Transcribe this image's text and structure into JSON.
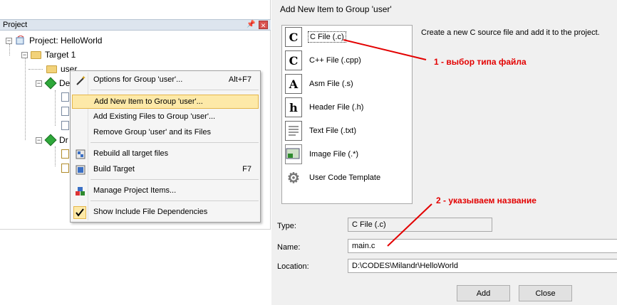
{
  "project_panel": {
    "title": "Project",
    "tree": {
      "project": "Project: HelloWorld",
      "target": "Target 1",
      "group_user": "user",
      "group_device": "De",
      "group_drivers": "Dr"
    }
  },
  "context_menu": {
    "items": [
      {
        "label": "Options for Group 'user'...",
        "shortcut": "Alt+F7",
        "icon": "magic-wand-icon"
      },
      {
        "label": "Add New  Item to Group 'user'...",
        "shortcut": "",
        "icon": ""
      },
      {
        "label": "Add Existing Files to Group 'user'...",
        "shortcut": "",
        "icon": ""
      },
      {
        "label": "Remove Group 'user' and its Files",
        "shortcut": "",
        "icon": ""
      },
      {
        "label": "Rebuild all target files",
        "shortcut": "",
        "icon": "rebuild-icon"
      },
      {
        "label": "Build Target",
        "shortcut": "F7",
        "icon": "build-icon"
      },
      {
        "label": "Manage Project Items...",
        "shortcut": "",
        "icon": "manage-items-icon"
      },
      {
        "label": "Show Include File Dependencies",
        "shortcut": "",
        "icon": "checkmark-icon"
      }
    ]
  },
  "dialog": {
    "title": "Add New Item to Group 'user'",
    "description": "Create a new C source file and add it to the project.",
    "file_types": [
      {
        "label": "C File (.c)",
        "glyph": "C"
      },
      {
        "label": "C++ File (.cpp)",
        "glyph": "C"
      },
      {
        "label": "Asm File (.s)",
        "glyph": "A"
      },
      {
        "label": "Header File (.h)",
        "glyph": "h"
      },
      {
        "label": "Text File (.txt)",
        "glyph": ""
      },
      {
        "label": "Image File (.*)",
        "glyph": ""
      },
      {
        "label": "User Code Template",
        "glyph": ""
      }
    ],
    "type_label": "Type:",
    "type_value": "C File (.c)",
    "name_label": "Name:",
    "name_value": "main.c",
    "location_label": "Location:",
    "location_value": "D:\\CODES\\Milandr\\HelloWorld",
    "add_button": "Add",
    "close_button": "Close"
  },
  "annotations": {
    "step1": "1 - выбор типа файла",
    "step2": "2 - указываем название",
    "color": "#e30000"
  }
}
